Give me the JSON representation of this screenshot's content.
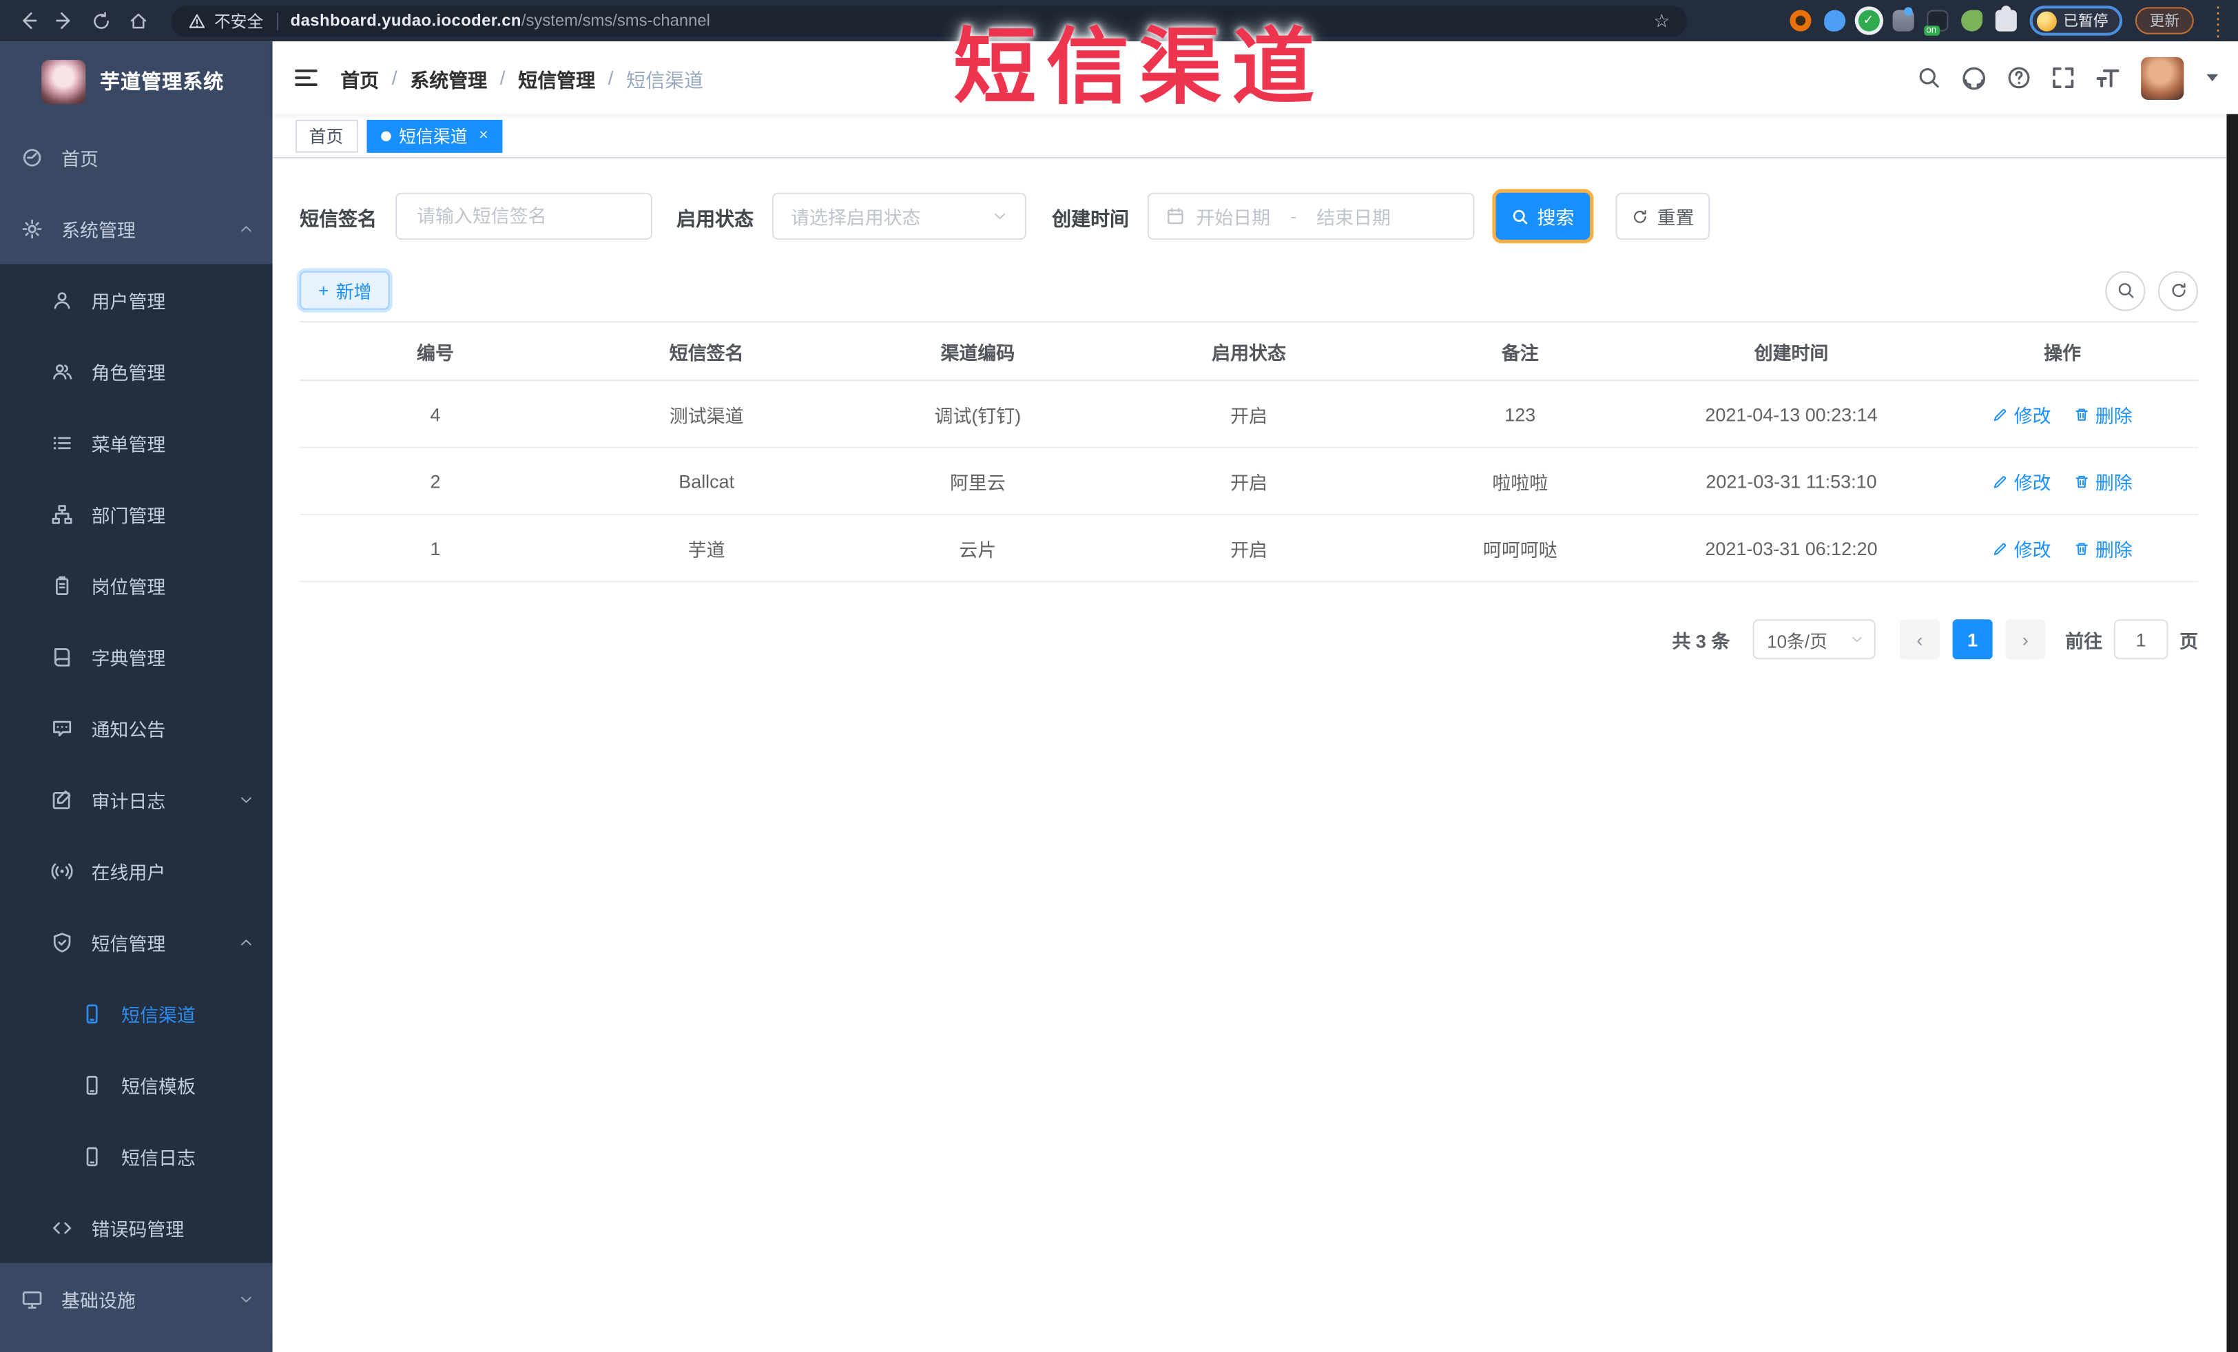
{
  "browser": {
    "security_label": "不安全",
    "url_host": "dashboard.yudao.iocoder.cn",
    "url_path": "/system/sms/sms-channel",
    "profile_status_badge": "已暂停",
    "update_button": "更新",
    "extension_on_badge": "on"
  },
  "annotation": {
    "text": "短信渠道",
    "color": "#ee3550"
  },
  "sidebar": {
    "app_title": "芋道管理系统",
    "items": [
      {
        "label": "首页"
      },
      {
        "label": "系统管理"
      },
      {
        "label": "用户管理"
      },
      {
        "label": "角色管理"
      },
      {
        "label": "菜单管理"
      },
      {
        "label": "部门管理"
      },
      {
        "label": "岗位管理"
      },
      {
        "label": "字典管理"
      },
      {
        "label": "通知公告"
      },
      {
        "label": "审计日志"
      },
      {
        "label": "在线用户"
      },
      {
        "label": "短信管理"
      },
      {
        "label": "短信渠道"
      },
      {
        "label": "短信模板"
      },
      {
        "label": "短信日志"
      },
      {
        "label": "错误码管理"
      },
      {
        "label": "基础设施"
      }
    ]
  },
  "header": {
    "breadcrumb": [
      "首页",
      "系统管理",
      "短信管理",
      "短信渠道"
    ],
    "separator": "/"
  },
  "tags": {
    "home": "首页",
    "active": "短信渠道",
    "close": "×"
  },
  "search_form": {
    "sign_label": "短信签名",
    "sign_placeholder": "请输入短信签名",
    "status_label": "启用状态",
    "status_placeholder": "请选择启用状态",
    "date_label": "创建时间",
    "date_start_placeholder": "开始日期",
    "date_separator": "-",
    "date_end_placeholder": "结束日期",
    "search_button": "搜索",
    "reset_button": "重置"
  },
  "toolbar": {
    "add_button": "新增",
    "add_plus": "+"
  },
  "table": {
    "headers": [
      "编号",
      "短信签名",
      "渠道编码",
      "启用状态",
      "备注",
      "创建时间",
      "操作"
    ],
    "rows": [
      [
        "4",
        "测试渠道",
        "调试(钉钉)",
        "开启",
        "123",
        "2021-04-13 00:23:14"
      ],
      [
        "2",
        "Ballcat",
        "阿里云",
        "开启",
        "啦啦啦",
        "2021-03-31 11:53:10"
      ],
      [
        "1",
        "芋道",
        "云片",
        "开启",
        "呵呵呵哒",
        "2021-03-31 06:12:20"
      ]
    ],
    "actions": {
      "edit": "修改",
      "delete": "删除"
    }
  },
  "pagination": {
    "total": "共 3 条",
    "page_size": "10条/页",
    "prev": "‹",
    "page": "1",
    "next": "›",
    "goto_label": "前往",
    "goto_value": "1",
    "page_unit": "页"
  },
  "colors": {
    "primary": "#1890ff",
    "sidebar_bg": "#3a4963",
    "sidebar_sub_bg": "#232e3e",
    "chrome_bg": "#242d3d",
    "annotation_red": "#ee3550"
  }
}
